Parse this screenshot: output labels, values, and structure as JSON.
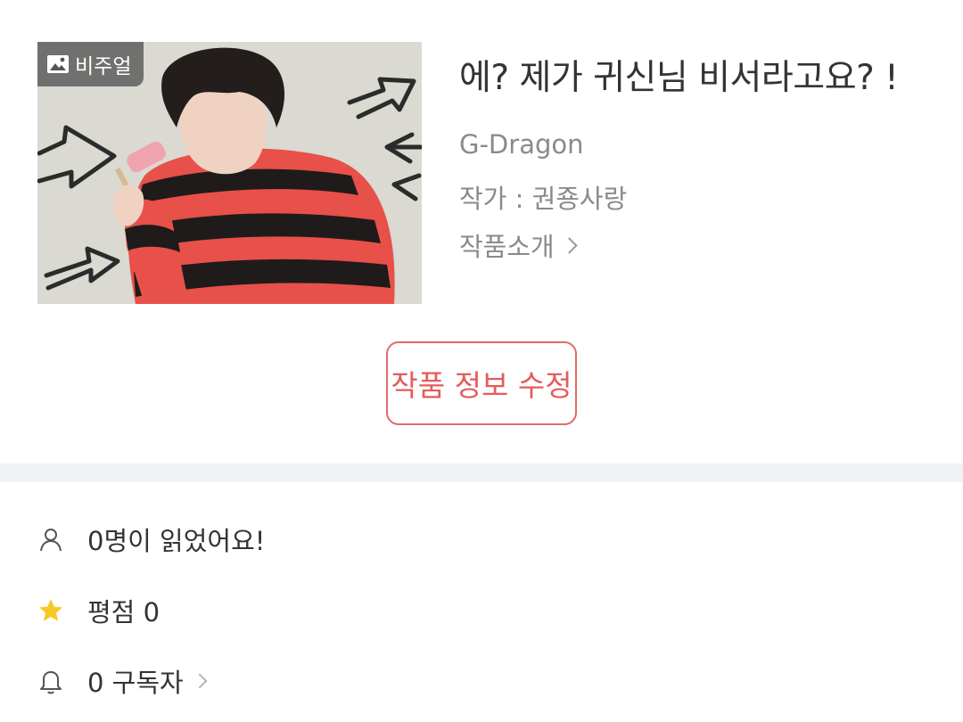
{
  "cover": {
    "image_alt": "cover illustration",
    "badge_label": "비주얼",
    "badge_icon": "image-icon"
  },
  "work": {
    "title": "에?  제가 귀신님 비서라고요? !",
    "subject": "G-Dragon",
    "author": "작가 : 권죵사랑",
    "intro_label": "작품소개"
  },
  "actions": {
    "edit_label": "작품 정보 수정"
  },
  "stats": {
    "readers": "0명이 읽었어요!",
    "rating": "평점 0",
    "subscribers": "0 구독자"
  },
  "colors": {
    "accent": "#e45c5c",
    "star": "#f7c928",
    "divider": "#f1f2f4",
    "muted_text": "#8a8a8a"
  }
}
